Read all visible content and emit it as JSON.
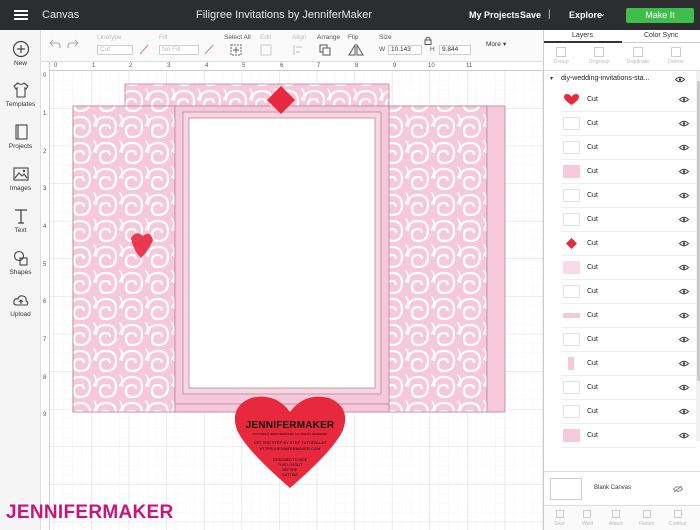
{
  "topbar": {
    "title": "Canvas",
    "document": "Filigree Invitations by JenniferMaker",
    "my_projects": "My Projects",
    "save": "Save",
    "separator": "|",
    "explore": "Explore",
    "make_it": "Make It",
    "make_it_color": "#3ebd4b"
  },
  "sidebar": {
    "items": [
      {
        "label": "New",
        "icon": "plus-circle-icon"
      },
      {
        "label": "Templates",
        "icon": "shirt-icon"
      },
      {
        "label": "Projects",
        "icon": "book-icon"
      },
      {
        "label": "Images",
        "icon": "image-icon"
      },
      {
        "label": "Text",
        "icon": "text-icon"
      },
      {
        "label": "Shapes",
        "icon": "shapes-icon"
      },
      {
        "label": "Upload",
        "icon": "cloud-upload-icon"
      }
    ]
  },
  "toolbar": {
    "linetype": "Linetype",
    "linetype_value": "Cut",
    "fill": "Fill",
    "fill_value": "No Fill",
    "select_all": "Select All",
    "edit": "Edit",
    "align": "Align",
    "arrange": "Arrange",
    "flip": "Flip",
    "size": "Size",
    "w_label": "W",
    "w_value": "10.143",
    "h_label": "H",
    "h_value": "9.844",
    "more": "More"
  },
  "rulers": {
    "top": [
      "0",
      "1",
      "2",
      "3",
      "4",
      "5",
      "6",
      "7",
      "8",
      "9",
      "10",
      "11"
    ],
    "left": [
      "0",
      "1",
      "2",
      "3",
      "4",
      "5",
      "6",
      "7",
      "8",
      "9"
    ]
  },
  "canvas": {
    "card_pink": "#f5c9d9",
    "card_red": "#e8283c",
    "heart_title": "JENNIFERMAKER",
    "heart_line1": "COPYRIGHT JENNIFERMAKER. ALL RIGHTS RESERVED",
    "heart_line2": "GET THE STEP BY STEP TUTORIAL AT",
    "heart_line3": "HTTPS://JENNIFERMAKER.COM",
    "heart_line4": "DESIGNED TO HIDE",
    "heart_line5": "THIS LOGOUT",
    "heart_line6": "BEFORE",
    "heart_line7": "CUTTING"
  },
  "panel": {
    "tab_layers": "Layers",
    "tab_color_sync": "Color Sync",
    "actions": [
      "Group",
      "Ungroup",
      "Duplicate",
      "Delete"
    ],
    "group_name": "diy-wedding-invitations-sta...",
    "layers": [
      {
        "label": "Cut",
        "thumb": "red-heart"
      },
      {
        "label": "Cut",
        "thumb": "blank"
      },
      {
        "label": "Cut",
        "thumb": "blank"
      },
      {
        "label": "Cut",
        "thumb": "pink"
      },
      {
        "label": "Cut",
        "thumb": "blank"
      },
      {
        "label": "Cut",
        "thumb": "blank"
      },
      {
        "label": "Cut",
        "thumb": "red-diamond"
      },
      {
        "label": "Cut",
        "thumb": "pink-light"
      },
      {
        "label": "Cut",
        "thumb": "blank"
      },
      {
        "label": "Cut",
        "thumb": "pink-strip"
      },
      {
        "label": "Cut",
        "thumb": "blank"
      },
      {
        "label": "Cut",
        "thumb": "pink-small"
      },
      {
        "label": "Cut",
        "thumb": "blank"
      },
      {
        "label": "Cut",
        "thumb": "blank"
      },
      {
        "label": "Cut",
        "thumb": "pink"
      }
    ],
    "blank_canvas": "Blank Canvas",
    "bottom_actions": [
      "Slice",
      "Weld",
      "Attach",
      "Flatten",
      "Contour"
    ]
  },
  "watermark": {
    "part1": "JENNIFER",
    "part2": "MAKER"
  }
}
